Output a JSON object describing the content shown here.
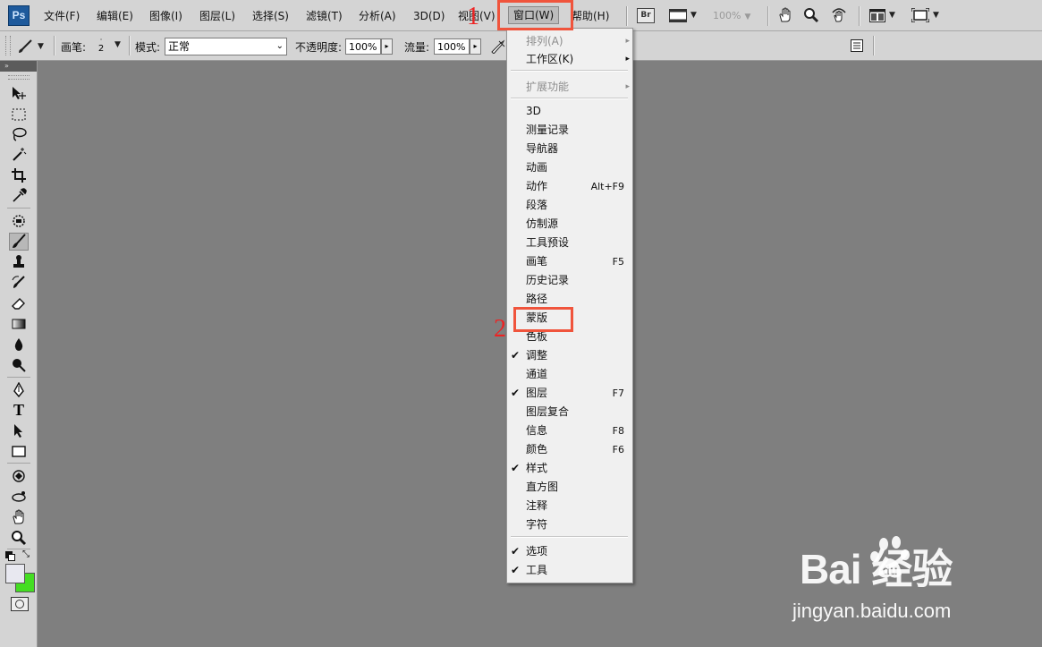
{
  "app": {
    "logo": "Ps"
  },
  "menubar": {
    "items": [
      "文件(F)",
      "编辑(E)",
      "图像(I)",
      "图层(L)",
      "选择(S)",
      "滤镜(T)",
      "分析(A)",
      "3D(D)",
      "视图(V)",
      "窗口(W)",
      "帮助(H)"
    ],
    "active": "窗口(W)",
    "bridge_label": "Br",
    "zoom": "100%"
  },
  "options_bar": {
    "brush_label": "画笔:",
    "brush_size": "2",
    "mode_label": "模式:",
    "mode_value": "正常",
    "opacity_label": "不透明度:",
    "opacity_value": "100%",
    "flow_label": "流量:",
    "flow_value": "100%"
  },
  "window_menu": {
    "items": [
      {
        "label": "排列(A)",
        "disabled": true,
        "submenu": true
      },
      {
        "label": "工作区(K)",
        "submenu": true
      },
      {
        "label": "扩展功能",
        "disabled": true,
        "submenu": true
      },
      {
        "label": "3D"
      },
      {
        "label": "测量记录"
      },
      {
        "label": "导航器"
      },
      {
        "label": "动画"
      },
      {
        "label": "动作",
        "shortcut": "Alt+F9"
      },
      {
        "label": "段落"
      },
      {
        "label": "仿制源"
      },
      {
        "label": "工具预设"
      },
      {
        "label": "画笔",
        "shortcut": "F5"
      },
      {
        "label": "历史记录"
      },
      {
        "label": "路径"
      },
      {
        "label": "蒙版"
      },
      {
        "label": "色板"
      },
      {
        "label": "调整",
        "checked": true
      },
      {
        "label": "通道"
      },
      {
        "label": "图层",
        "checked": true,
        "shortcut": "F7"
      },
      {
        "label": "图层复合"
      },
      {
        "label": "信息",
        "shortcut": "F8"
      },
      {
        "label": "颜色",
        "shortcut": "F6"
      },
      {
        "label": "样式",
        "checked": true
      },
      {
        "label": "直方图"
      },
      {
        "label": "注释"
      },
      {
        "label": "字符"
      },
      {
        "label": "选项",
        "checked": true
      },
      {
        "label": "工具",
        "checked": true
      }
    ],
    "check_glyph": "✔",
    "submenu_glyph": "▸"
  },
  "annotations": {
    "step1": "1",
    "step2": "2"
  },
  "watermark": {
    "brand": "Bai  经验",
    "url": "jingyan.baidu.com"
  },
  "colors": {
    "foreground": "#e8e8f0",
    "background": "#44dd22",
    "highlight": "#f0543c",
    "canvas": "#7f7f7f"
  }
}
